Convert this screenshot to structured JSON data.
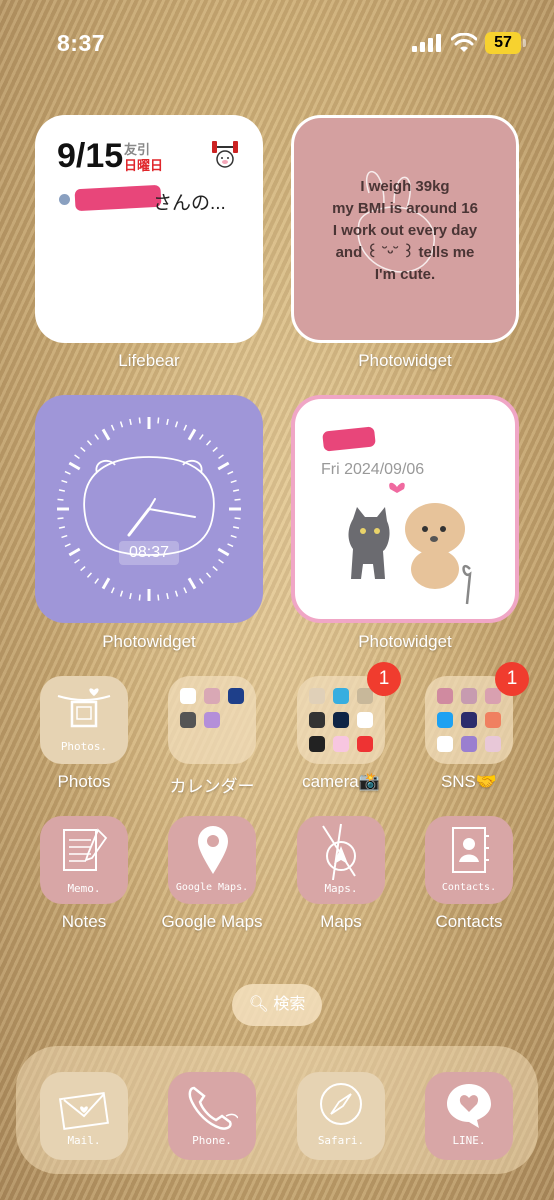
{
  "status_bar": {
    "time": "8:37",
    "battery": "57"
  },
  "widgets": {
    "lifebear": {
      "date": "9/15",
      "rokuyo": "友引",
      "weekday": "日曜日",
      "text": "さんの...",
      "label": "Lifebear"
    },
    "photowidget_text": {
      "text": "I weigh 39kg\nmy BMI is around 16\nI work out every day\nand ꒰ ˘ᵕ˘ ꒱ tells me\nI'm cute.",
      "label": "Photowidget"
    },
    "photowidget_clock": {
      "time": "08:37",
      "label": "Photowidget"
    },
    "photowidget_date": {
      "date": "Fri 2024/09/06",
      "label": "Photowidget"
    }
  },
  "apps_row1": [
    {
      "label": "Photos",
      "caption": "Photos."
    },
    {
      "label": "カレンダー"
    },
    {
      "label": "camera📸",
      "badge": "1"
    },
    {
      "label": "SNS🤝",
      "badge": "1"
    }
  ],
  "apps_row2": [
    {
      "label": "Notes",
      "caption": "Memo."
    },
    {
      "label": "Google Maps",
      "caption": "Google Maps."
    },
    {
      "label": "Maps",
      "caption": "Maps."
    },
    {
      "label": "Contacts",
      "caption": "Contacts."
    }
  ],
  "search": {
    "label": "検索"
  },
  "dock": [
    {
      "caption": "Mail."
    },
    {
      "caption": "Phone."
    },
    {
      "caption": "Safari."
    },
    {
      "caption": "LINE."
    }
  ]
}
